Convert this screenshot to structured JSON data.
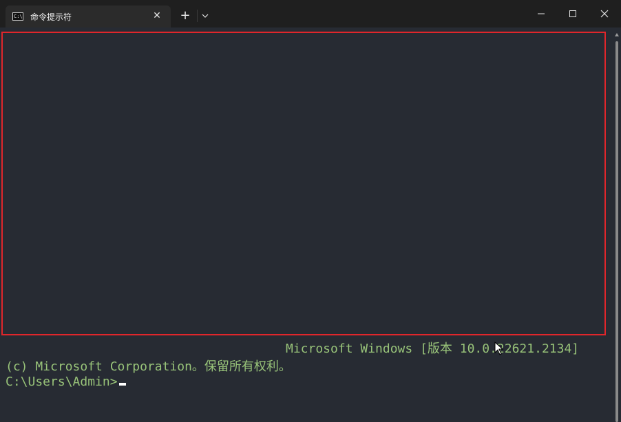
{
  "window": {
    "tab_title": "命令提示符",
    "tab_icon": "cmd-icon",
    "tab_icon_text": "C:\\",
    "close_tab_symbol": "✕",
    "new_tab_symbol": "+",
    "dropdown_icon": "chevron-down-icon",
    "minimize_icon": "minimize-icon",
    "maximize_icon": "maximize-icon",
    "close_icon": "close-icon"
  },
  "terminal": {
    "lines": [
      "Microsoft Windows [版本 10.0.22621.2134]",
      "(c) Microsoft Corporation。保留所有权利。",
      "C:\\Users\\Admin>"
    ]
  },
  "colors": {
    "titlebar_bg": "#1f1f1f",
    "tab_bg": "#2b2b2b",
    "terminal_bg": "#272b33",
    "terminal_text": "#98c379",
    "highlight_border": "#e0262b"
  }
}
